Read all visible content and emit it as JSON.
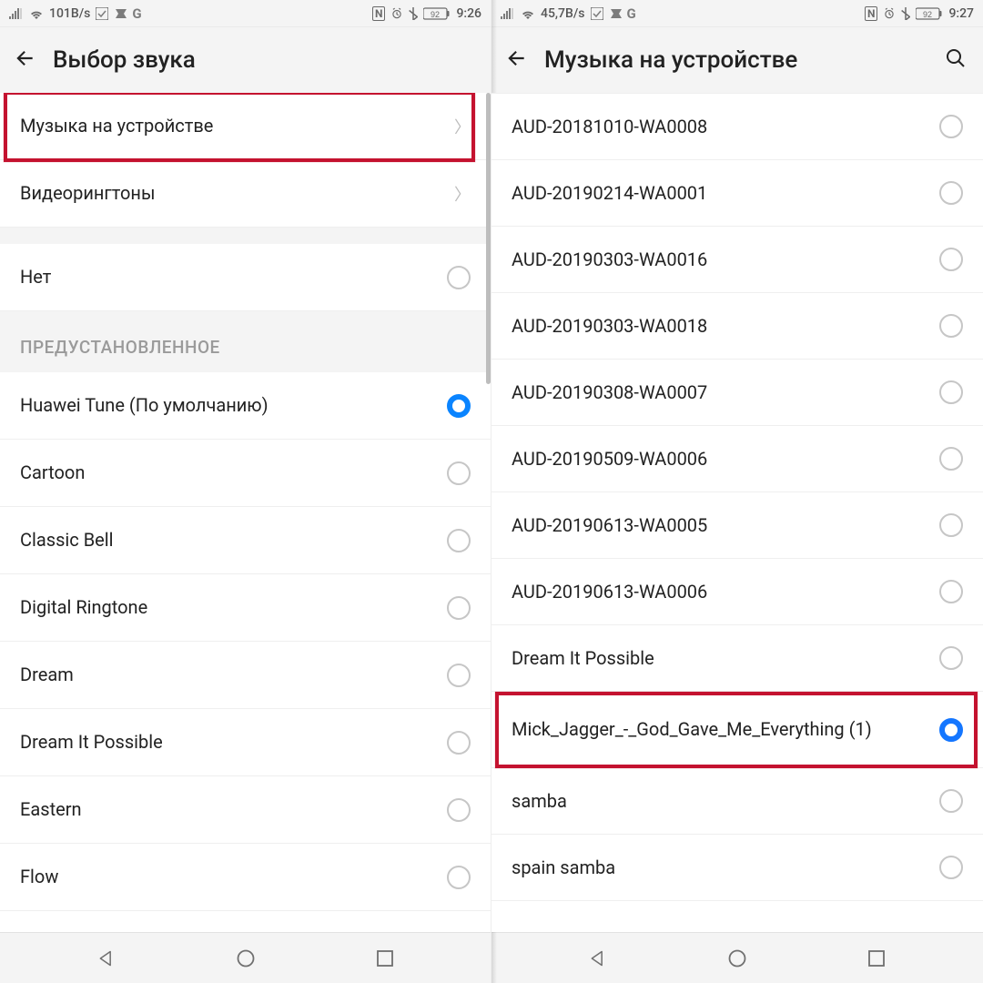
{
  "left": {
    "status": {
      "net": "101B/s",
      "battery": "92",
      "time": "9:26"
    },
    "title": "Выбор звука",
    "nav_items": [
      {
        "label": "Музыка на устройстве",
        "highlight": true
      },
      {
        "label": "Видеорингтоны"
      }
    ],
    "none_label": "Нет",
    "section": "ПРЕДУСТАНОВЛЕННОЕ",
    "presets": [
      {
        "label": "Huawei Tune (По умолчанию)",
        "selected": true
      },
      {
        "label": "Cartoon"
      },
      {
        "label": "Classic Bell"
      },
      {
        "label": "Digital Ringtone"
      },
      {
        "label": "Dream"
      },
      {
        "label": "Dream It Possible"
      },
      {
        "label": "Eastern"
      },
      {
        "label": "Flow"
      }
    ]
  },
  "right": {
    "status": {
      "net": "45,7B/s",
      "battery": "92",
      "time": "9:27"
    },
    "title": "Музыка на устройстве",
    "tracks": [
      {
        "label": "AUD-20181010-WA0008"
      },
      {
        "label": "AUD-20190214-WA0001"
      },
      {
        "label": "AUD-20190303-WA0016"
      },
      {
        "label": "AUD-20190303-WA0018"
      },
      {
        "label": "AUD-20190308-WA0007"
      },
      {
        "label": "AUD-20190509-WA0006"
      },
      {
        "label": "AUD-20190613-WA0005"
      },
      {
        "label": "AUD-20190613-WA0006"
      },
      {
        "label": "Dream It Possible"
      },
      {
        "label": "Mick_Jagger_-_God_Gave_Me_Everything (1)",
        "selected": true,
        "highlight": true
      },
      {
        "label": "samba"
      },
      {
        "label": "spain samba"
      }
    ]
  }
}
